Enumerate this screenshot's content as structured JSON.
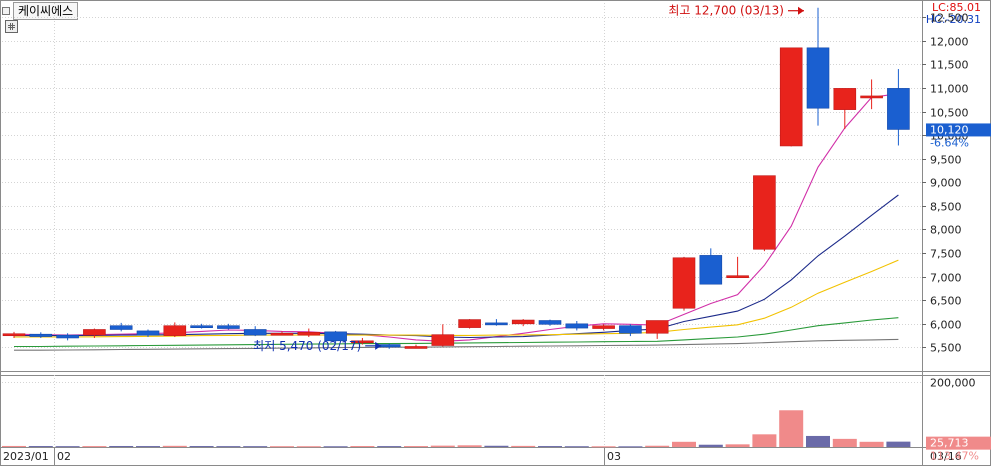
{
  "header": {
    "stock_name": "케이씨에스",
    "lc_label": "LC:85.01",
    "hc_label": "HC:-20.31"
  },
  "colors": {
    "up": "#e8231c",
    "down": "#1a5fd0",
    "vol_up": "#f08a8a",
    "vol_down": "#6a6aa8",
    "ma5": "#d12fa8",
    "ma10": "#1c2a8a",
    "ma20": "#f2c200",
    "ma60": "#2a9a3a",
    "ma120": "#777777",
    "grid": "#d4d4d4",
    "price_badge": "#1a5fd0"
  },
  "chart_data": {
    "type": "candlestick",
    "price_axis": {
      "min": 5000,
      "max": 12800,
      "ticks": [
        5500,
        6000,
        6500,
        7000,
        7500,
        8000,
        8500,
        9000,
        9500,
        10000,
        10500,
        11000,
        11500,
        12000,
        12500
      ]
    },
    "volume_axis": {
      "max": 200000,
      "ticks": [
        200000
      ],
      "tick_labels": [
        "200,000"
      ]
    },
    "x_labels": [
      "2023/01",
      "02",
      "03",
      "03/16"
    ],
    "annotations": {
      "high": "최고 12,700 (03/13)",
      "low": "최저 5,470 (02/17)"
    },
    "last_price": {
      "value": "10,120",
      "change": "-6.64%"
    },
    "last_volume": {
      "value": "25,713",
      "change": "113.47%"
    },
    "candles": [
      {
        "o": 5790,
        "h": 5830,
        "l": 5700,
        "c": 5790
      },
      {
        "o": 5780,
        "h": 5820,
        "l": 5700,
        "c": 5730
      },
      {
        "o": 5760,
        "h": 5800,
        "l": 5650,
        "c": 5700
      },
      {
        "o": 5760,
        "h": 5900,
        "l": 5700,
        "c": 5880
      },
      {
        "o": 5960,
        "h": 6020,
        "l": 5840,
        "c": 5880
      },
      {
        "o": 5850,
        "h": 5880,
        "l": 5720,
        "c": 5760
      },
      {
        "o": 5750,
        "h": 6030,
        "l": 5720,
        "c": 5960
      },
      {
        "o": 5960,
        "h": 6000,
        "l": 5900,
        "c": 5950
      },
      {
        "o": 5960,
        "h": 6000,
        "l": 5880,
        "c": 5900
      },
      {
        "o": 5880,
        "h": 5950,
        "l": 5740,
        "c": 5760
      },
      {
        "o": 5780,
        "h": 5840,
        "l": 5760,
        "c": 5800
      },
      {
        "o": 5760,
        "h": 5900,
        "l": 5720,
        "c": 5820
      },
      {
        "o": 5830,
        "h": 5850,
        "l": 5600,
        "c": 5640
      },
      {
        "o": 5640,
        "h": 5700,
        "l": 5560,
        "c": 5640
      },
      {
        "o": 5560,
        "h": 5580,
        "l": 5470,
        "c": 5510
      },
      {
        "o": 5510,
        "h": 5560,
        "l": 5480,
        "c": 5520
      },
      {
        "o": 5540,
        "h": 5990,
        "l": 5520,
        "c": 5770
      },
      {
        "o": 5920,
        "h": 6100,
        "l": 5900,
        "c": 6090
      },
      {
        "o": 6020,
        "h": 6100,
        "l": 5960,
        "c": 6000
      },
      {
        "o": 6000,
        "h": 6100,
        "l": 5950,
        "c": 6080
      },
      {
        "o": 6070,
        "h": 6090,
        "l": 5960,
        "c": 5990
      },
      {
        "o": 6000,
        "h": 6060,
        "l": 5860,
        "c": 5910
      },
      {
        "o": 5900,
        "h": 5990,
        "l": 5860,
        "c": 5960
      },
      {
        "o": 5960,
        "h": 5990,
        "l": 5740,
        "c": 5800
      },
      {
        "o": 5800,
        "h": 6070,
        "l": 5680,
        "c": 6070
      },
      {
        "o": 6330,
        "h": 7420,
        "l": 6280,
        "c": 7400
      },
      {
        "o": 7450,
        "h": 7600,
        "l": 6850,
        "c": 6840
      },
      {
        "o": 7000,
        "h": 7420,
        "l": 6970,
        "c": 7020
      },
      {
        "o": 7580,
        "h": 9140,
        "l": 7540,
        "c": 9140
      },
      {
        "o": 9770,
        "h": 11850,
        "l": 9760,
        "c": 11850
      },
      {
        "o": 11850,
        "h": 12700,
        "l": 10200,
        "c": 10570
      },
      {
        "o": 10540,
        "h": 10990,
        "l": 10130,
        "c": 10990
      },
      {
        "o": 10800,
        "h": 11180,
        "l": 10550,
        "c": 10830
      },
      {
        "o": 10990,
        "h": 11400,
        "l": 9780,
        "c": 10120
      }
    ],
    "volumes": [
      3200,
      3000,
      2600,
      2800,
      3100,
      2900,
      3600,
      3000,
      2700,
      2600,
      2500,
      2400,
      2300,
      3000,
      2800,
      2900,
      4200,
      5200,
      3800,
      3400,
      2900,
      2400,
      2200,
      2100,
      3900,
      16000,
      7000,
      8200,
      39000,
      113000,
      34000,
      25000,
      16000,
      16500
    ],
    "moving_averages": [
      {
        "name": "ma5",
        "values": [
          5780,
          5770,
          5760,
          5770,
          5780,
          5790,
          5810,
          5840,
          5870,
          5860,
          5840,
          5830,
          5800,
          5770,
          5720,
          5660,
          5630,
          5660,
          5730,
          5800,
          5880,
          5950,
          6000,
          5990,
          5970,
          6200,
          6430,
          6620,
          7240,
          8070,
          9320,
          10150,
          10800,
          10880
        ]
      },
      {
        "name": "ma10",
        "values": [
          5750,
          5750,
          5750,
          5755,
          5760,
          5765,
          5770,
          5780,
          5790,
          5800,
          5800,
          5800,
          5790,
          5780,
          5760,
          5750,
          5720,
          5710,
          5720,
          5730,
          5760,
          5790,
          5820,
          5860,
          5890,
          6050,
          6160,
          6270,
          6520,
          6930,
          7440,
          7860,
          8300,
          8730,
          9050
        ]
      },
      {
        "name": "ma20",
        "values": [
          5720,
          5720,
          5720,
          5725,
          5730,
          5735,
          5740,
          5750,
          5755,
          5760,
          5760,
          5760,
          5760,
          5760,
          5760,
          5760,
          5755,
          5755,
          5760,
          5765,
          5770,
          5780,
          5790,
          5800,
          5820,
          5880,
          5930,
          5980,
          6120,
          6350,
          6650,
          6880,
          7110,
          7350,
          7470
        ]
      },
      {
        "name": "ma60",
        "values": [
          5520,
          5520,
          5525,
          5530,
          5535,
          5540,
          5545,
          5550,
          5555,
          5560,
          5565,
          5570,
          5575,
          5580,
          5580,
          5585,
          5590,
          5595,
          5600,
          5605,
          5610,
          5615,
          5620,
          5625,
          5630,
          5660,
          5690,
          5720,
          5780,
          5870,
          5960,
          6020,
          6080,
          6130,
          6160
        ]
      },
      {
        "name": "ma120",
        "values": [
          5440,
          5440,
          5445,
          5450,
          5455,
          5460,
          5465,
          5470,
          5475,
          5480,
          5485,
          5490,
          5495,
          5500,
          5505,
          5505,
          5510,
          5515,
          5520,
          5525,
          5530,
          5535,
          5540,
          5545,
          5550,
          5560,
          5570,
          5580,
          5600,
          5620,
          5640,
          5650,
          5660,
          5670,
          5680
        ]
      }
    ]
  }
}
